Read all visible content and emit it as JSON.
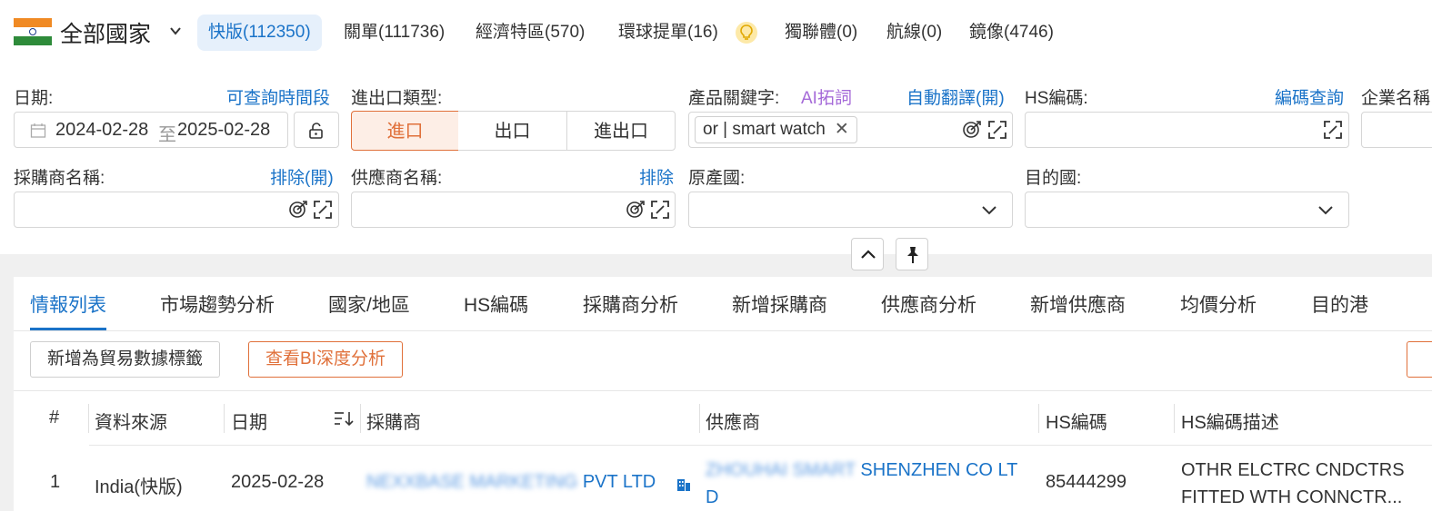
{
  "topbar": {
    "country": "全部國家",
    "tabs": [
      {
        "label": "快版(112350)",
        "active": true
      },
      {
        "label": "關單(111736)"
      },
      {
        "label": "經濟特區(570)"
      },
      {
        "label": "環球提單(16)"
      },
      {
        "label": "獨聯體(0)"
      },
      {
        "label": "航線(0)"
      },
      {
        "label": "鏡像(4746)"
      }
    ]
  },
  "filters": {
    "date_label": "日期:",
    "date_link": "可查詢時間段",
    "date_start": "2024-02-28",
    "date_sep": "至",
    "date_end": "2025-02-28",
    "trade_type_label": "進出口類型:",
    "trade_types": [
      "進口",
      "出口",
      "進出口"
    ],
    "keyword_label": "產品關鍵字:",
    "ai_link": "AI拓詞",
    "translate_link": "自動翻譯(開)",
    "keyword_tag": "or | smart watch",
    "hs_label": "HS編碼:",
    "hs_link": "編碼查詢",
    "company_label": "企業名稱",
    "buyer_label": "採購商名稱:",
    "buyer_link": "排除(開)",
    "supplier_label": "供應商名稱:",
    "supplier_link": "排除",
    "origin_label": "原產國:",
    "dest_label": "目的國:"
  },
  "analysis_tabs": [
    "情報列表",
    "市場趨勢分析",
    "國家/地區",
    "HS編碼",
    "採購商分析",
    "新增採購商",
    "供應商分析",
    "新增供應商",
    "均價分析",
    "目的港"
  ],
  "actions": {
    "add_tag": "新增為貿易數據標籤",
    "bi": "查看BI深度分析"
  },
  "table": {
    "headers": [
      "#",
      "資料來源",
      "日期",
      "採購商",
      "供應商",
      "HS編碼",
      "HS編碼描述"
    ],
    "rows": [
      {
        "num": "1",
        "source": "India(快版)",
        "date": "2025-02-28",
        "buyer_hidden": "NEXXBASE MARKETING",
        "buyer_visible": "PVT LTD",
        "supplier_hidden": "ZHOUHAI SMART",
        "supplier_visible_1": "SHENZHEN CO LT",
        "supplier_visible_2": "D",
        "hs": "85444299",
        "desc_1": "OTHR ELCTRC CNDCTRS",
        "desc_2": "FITTED WTH CONNCTR..."
      }
    ]
  },
  "colors": {
    "accent": "#1a73c8",
    "orange": "#e0703a",
    "purple": "#a56ad8"
  }
}
